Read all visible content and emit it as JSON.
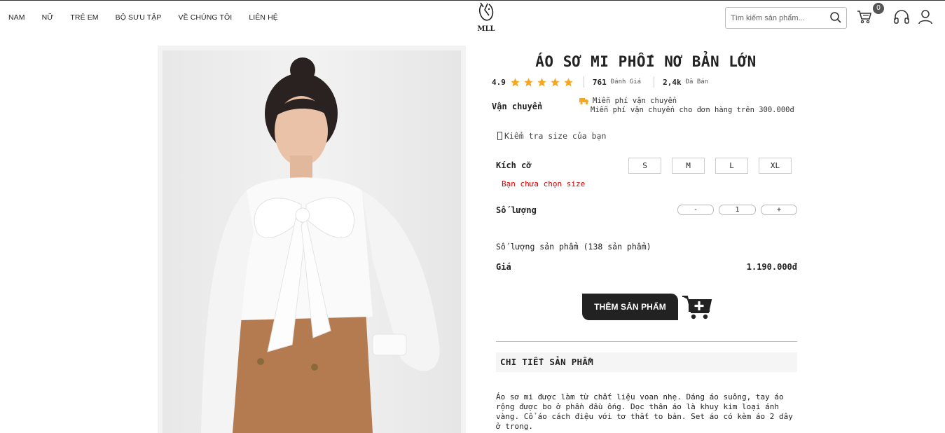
{
  "header": {
    "nav": [
      "NAM",
      "NỮ",
      "TRẺ EM",
      "BỘ SƯU TẬP",
      "VỀ CHÚNG TÔI",
      "LIÊN HỆ"
    ],
    "logo_text": "MLL",
    "search_placeholder": "Tìm kiếm sản phẩm...",
    "cart_count": "0"
  },
  "product": {
    "title": "ÁO SƠ MI PHỐI NƠ BẢN LỚN",
    "rating": "4.9",
    "stars": 5,
    "review_count": "761",
    "review_label": "Đánh Giá",
    "sold_count": "2,4k",
    "sold_label": "Đã Bán",
    "shipping_label": "Vận chuyển",
    "shipping_title": "Miễn phí vận chuyển",
    "shipping_desc": "Miễn phí vận chuyển cho đơn hàng trên 300.000đ",
    "size_check": "Kiểm tra size của bạn",
    "size_label": "Kích cỡ",
    "sizes": [
      "S",
      "M",
      "L",
      "XL"
    ],
    "size_error": "Bạn chưa chọn size",
    "qty_label": "Số lượng",
    "qty_minus": "-",
    "qty_value": "1",
    "qty_plus": "+",
    "stock_text": "Số lượng sản phẩm (138 sản phẩm)",
    "price_label": "Giá",
    "price": "1.190.000đ",
    "add_button": "THÊM SẢN PHẨM",
    "detail_heading": "CHI TIẾT SẢN PHẨM",
    "description": "Áo sơ mi được làm từ chất liệu voan nhẹ. Dáng áo suông, tay áo rộng được bo ở phần đầu ống. Dọc thân áo là khuy kim loại ánh vàng. Cổ áo cách điệu với tơ thắt to bản. Set áo có kèm áo 2 dây ở trong."
  },
  "colors": {
    "star": "#f5a623",
    "error": "#e00000",
    "button": "#222222",
    "truck": "#f5a623"
  }
}
